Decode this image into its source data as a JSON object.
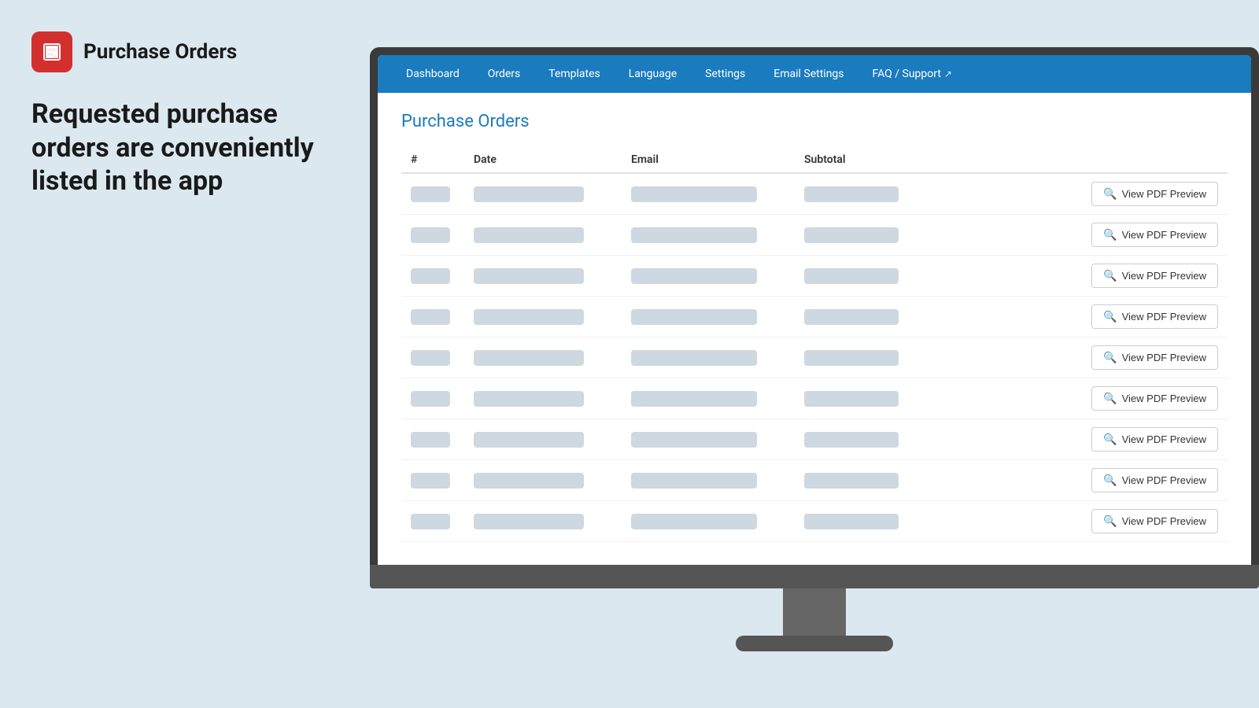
{
  "brand": {
    "name": "Purchase Orders",
    "logo_alt": "Purchase Orders Logo"
  },
  "tagline": "Requested purchase orders are conveniently listed in the app",
  "navbar": {
    "items": [
      {
        "id": "dashboard",
        "label": "Dashboard",
        "active": false,
        "external": false
      },
      {
        "id": "orders",
        "label": "Orders",
        "active": false,
        "external": false
      },
      {
        "id": "templates",
        "label": "Templates",
        "active": false,
        "external": false
      },
      {
        "id": "language",
        "label": "Language",
        "active": false,
        "external": false
      },
      {
        "id": "settings",
        "label": "Settings",
        "active": false,
        "external": false
      },
      {
        "id": "email-settings",
        "label": "Email Settings",
        "active": false,
        "external": false
      },
      {
        "id": "faq-support",
        "label": "FAQ / Support",
        "active": false,
        "external": true
      }
    ]
  },
  "page": {
    "title": "Purchase Orders"
  },
  "table": {
    "columns": [
      "#",
      "Date",
      "Email",
      "Subtotal"
    ],
    "rows": 9,
    "view_pdf_label": "View PDF Preview"
  }
}
